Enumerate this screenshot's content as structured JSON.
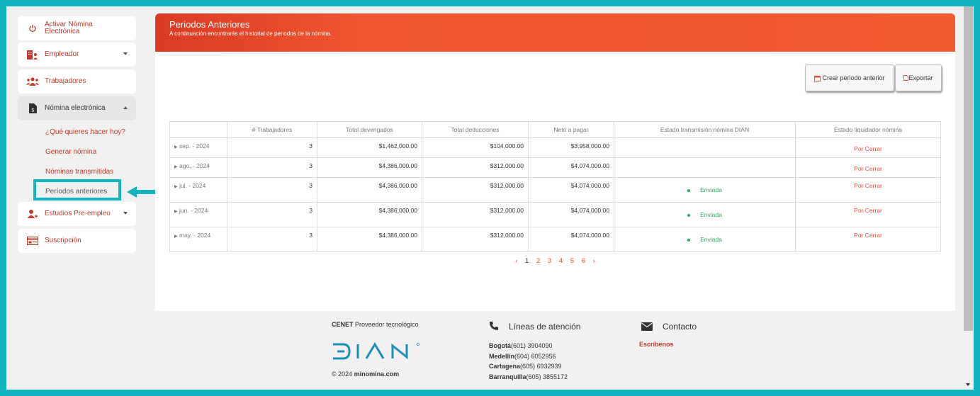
{
  "sidebar": {
    "items": [
      {
        "label1": "Activar Nómina",
        "label2": "Electrónica",
        "icon": "power-icon"
      },
      {
        "label": "Empleador",
        "icon": "building-icon"
      },
      {
        "label": "Trabajadores",
        "icon": "users-icon"
      },
      {
        "label": "Nómina electrónica",
        "icon": "document-dollar-icon"
      },
      {
        "label": "Estudios Pre-empleo",
        "icon": "user-plus-icon"
      },
      {
        "label": "Suscripción",
        "icon": "card-icon"
      }
    ],
    "subitems": [
      "¿Qué quieres hacer hoy?",
      "Generar nómina",
      "Nóminas transmitidas",
      "Períodos anteriores"
    ]
  },
  "banner": {
    "title": "Periodos Anteriores",
    "subtitle": "A continuación encontrarás el historial de periodos de la nómina."
  },
  "actions": {
    "create": "Crear periodo anterior",
    "export": "Exportar"
  },
  "table": {
    "headers": [
      "",
      "# Trabajadores",
      "Total devengados",
      "Total deducciones",
      "Neto a pagar",
      "Estado transmisión nómina DIAN",
      "Estado liquidador nómina"
    ],
    "rows": [
      {
        "period": "sep. - 2024",
        "workers": "3",
        "devengados": "$1,462,000.00",
        "deducciones": "$104,000.00",
        "neto": "$3,958,000.00",
        "dian": "",
        "liquidador": "Por Cerrar"
      },
      {
        "period": "ago. - 2024",
        "workers": "3",
        "devengados": "$4,386,000.00",
        "deducciones": "$312,000.00",
        "neto": "$4,074,000.00",
        "dian": "",
        "liquidador": "Por Cerrar"
      },
      {
        "period": "jul. - 2024",
        "workers": "3",
        "devengados": "$4,386,000.00",
        "deducciones": "$312,000.00",
        "neto": "$4,074,000.00",
        "dian": "Enviada",
        "liquidador": "Por Cerrar"
      },
      {
        "period": "jun. - 2024",
        "workers": "3",
        "devengados": "$4,386,000.00",
        "deducciones": "$312,000.00",
        "neto": "$4,074,000.00",
        "dian": "Enviada",
        "liquidador": "Por Cerrar"
      },
      {
        "period": "may. - 2024",
        "workers": "3",
        "devengados": "$4,386,000.00",
        "deducciones": "$312,000.00",
        "neto": "$4,074,000.00",
        "dian": "Enviada",
        "liquidador": "Por Cerrar"
      }
    ]
  },
  "pagination": {
    "prev": "‹",
    "pages": [
      "1",
      "2",
      "3",
      "4",
      "5",
      "6"
    ],
    "next": "›",
    "current": "1"
  },
  "footer": {
    "provider_bold": "CENET",
    "provider": "Proveedor tecnológico",
    "logo": "DIAN",
    "copyright_prefix": "© 2024",
    "copyright_site": "minomina.com",
    "lines_title": "Líneas de atención",
    "lines": [
      {
        "city": "Bogotá",
        "phone": "(601) 3904090"
      },
      {
        "city": "Medellín",
        "phone": "(604) 6052956"
      },
      {
        "city": "Cartagena",
        "phone": "(605) 6932939"
      },
      {
        "city": "Barranquilla",
        "phone": "(605) 3855172"
      }
    ],
    "contact_title": "Contacto",
    "contact_link": "Escríbenos"
  },
  "colors": {
    "accent": "#f25a30",
    "highlight": "#13b3bf",
    "link": "#c0392b",
    "success": "#27ae60"
  }
}
